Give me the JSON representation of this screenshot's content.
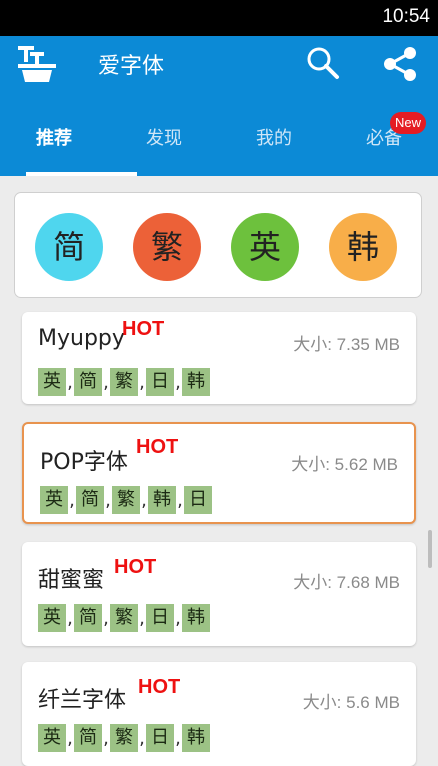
{
  "status_bar": {
    "time": "10:54"
  },
  "app_bar": {
    "title": "爱字体",
    "icons": [
      "app-logo-icon",
      "search-icon",
      "share-icon"
    ]
  },
  "tabs": [
    {
      "label": "推荐",
      "active": true
    },
    {
      "label": "发现",
      "active": false
    },
    {
      "label": "我的",
      "active": false
    },
    {
      "label": "必备",
      "active": false,
      "badge": "New"
    }
  ],
  "language_filters": [
    {
      "label": "简",
      "color": "#4fd6ee"
    },
    {
      "label": "繁",
      "color": "#ec6138"
    },
    {
      "label": "英",
      "color": "#6dc13d"
    },
    {
      "label": "韩",
      "color": "#f8ae49"
    }
  ],
  "fonts": [
    {
      "name": "Myuppy",
      "hot": "HOT",
      "size": "大小: 7.35 MB",
      "tags": [
        "英",
        "简",
        "繁",
        "日",
        "韩"
      ],
      "highlighted": false
    },
    {
      "name": "POP字体",
      "hot": "HOT",
      "size": "大小: 5.62 MB",
      "tags": [
        "英",
        "简",
        "繁",
        "韩",
        "日"
      ],
      "highlighted": true
    },
    {
      "name": "甜蜜蜜",
      "hot": "HOT",
      "size": "大小: 7.68 MB",
      "tags": [
        "英",
        "简",
        "繁",
        "日",
        "韩"
      ],
      "highlighted": false
    },
    {
      "name": "纤兰字体",
      "hot": "HOT",
      "size": "大小: 5.6 MB",
      "tags": [
        "英",
        "简",
        "繁",
        "日",
        "韩"
      ],
      "highlighted": false
    }
  ],
  "colors": {
    "primary": "#0c8ad6",
    "hot": "#ee1111",
    "tag_bg": "#9cc285",
    "highlight_border": "#e8934e"
  }
}
